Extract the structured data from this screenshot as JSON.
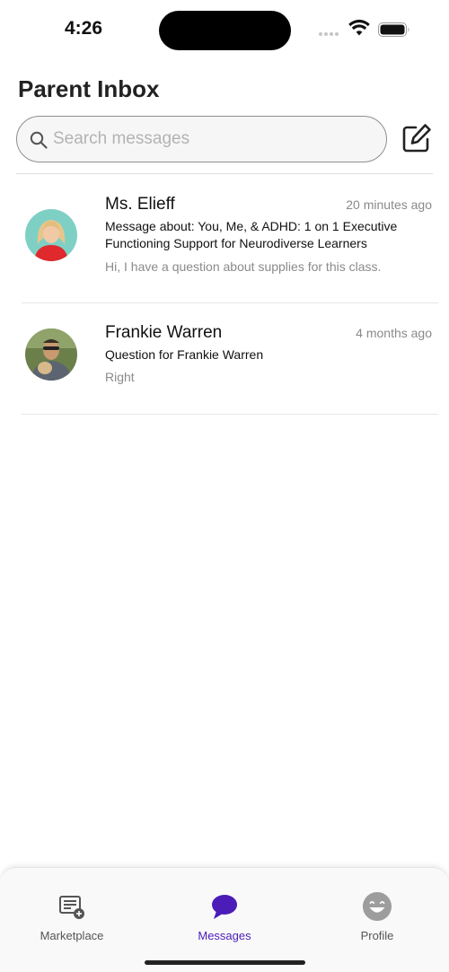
{
  "status_bar": {
    "time": "4:26"
  },
  "header": {
    "title": "Parent Inbox",
    "search_placeholder": "Search messages"
  },
  "conversations": [
    {
      "name": "Ms. Elieff",
      "time": "20 minutes ago",
      "subject": "Message about: You, Me, & ADHD: 1 on 1 Executive Functioning Support for Neurodiverse Learners",
      "preview": "Hi, I have a question about supplies for this class."
    },
    {
      "name": "Frankie Warren",
      "time": "4 months ago",
      "subject": "Question for Frankie Warren",
      "preview": "Right"
    }
  ],
  "tab_bar": {
    "tabs": [
      {
        "label": "Marketplace",
        "icon": "marketplace-icon",
        "active": false
      },
      {
        "label": "Messages",
        "icon": "chat-bubble-icon",
        "active": true
      },
      {
        "label": "Profile",
        "icon": "profile-avatar-icon",
        "active": false
      }
    ]
  },
  "colors": {
    "accent": "#4b1cb8",
    "text_secondary": "#8a8a8a",
    "search_border": "#8e8e8e"
  }
}
